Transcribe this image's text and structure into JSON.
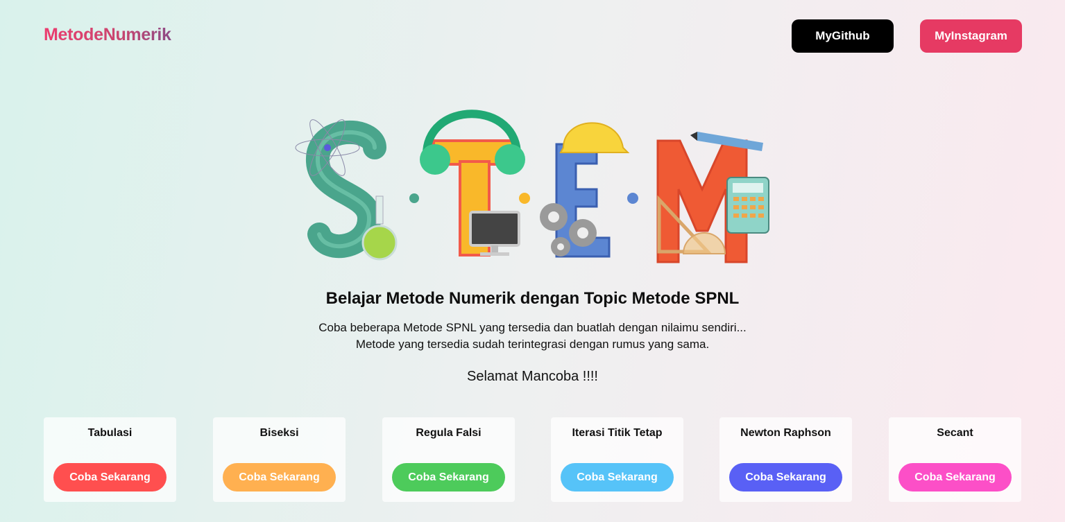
{
  "header": {
    "logo": "MetodeNumerik",
    "github_label": "MyGithub",
    "instagram_label": "MyInstagram"
  },
  "hero": {
    "title": "Belajar Metode Numerik dengan Topic Metode SPNL",
    "subtitle_line1": "Coba beberapa Metode SPNL yang tersedia dan buatlah dengan nilaimu sendiri...",
    "subtitle_line2": "Metode yang tersedia sudah terintegrasi dengan rumus yang sama.",
    "greeting": "Selamat Mancoba !!!!"
  },
  "cards": [
    {
      "title": "Tabulasi",
      "button": "Coba Sekarang",
      "color": "#ff4f4f"
    },
    {
      "title": "Biseksi",
      "button": "Coba Sekarang",
      "color": "#ffb050"
    },
    {
      "title": "Regula Falsi",
      "button": "Coba Sekarang",
      "color": "#4dcb5b"
    },
    {
      "title": "Iterasi Titik Tetap",
      "button": "Coba Sekarang",
      "color": "#56c3f8"
    },
    {
      "title": "Newton Raphson",
      "button": "Coba Sekarang",
      "color": "#5960f5"
    },
    {
      "title": "Secant",
      "button": "Coba Sekarang",
      "color": "#fc4fc7"
    }
  ],
  "colors": {
    "brand_pink": "#e63a63",
    "github_black": "#000000"
  }
}
